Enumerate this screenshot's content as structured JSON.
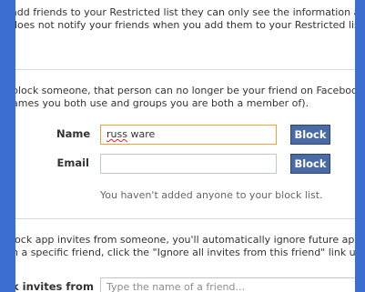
{
  "restricted_section": {
    "line1": "add friends to your Restricted list they can only see the information and p",
    "line2": "does not notify your friends when you add them to your Restricted list. Ec"
  },
  "block_users_section": {
    "line1": "block someone, that person can no longer be your friend on Facebook or i",
    "line2": "ames you both use and groups you are both a member of).",
    "name_label": "Name",
    "name_value": "russ",
    "name_value_rest": " ware",
    "email_label": "Email",
    "email_value": "",
    "block_button_label": "Block",
    "helper_text": "You haven't added anyone to your block list."
  },
  "block_app_invites_section": {
    "line1": "lock app invites from someone, you'll automatically ignore future app requ",
    "line2": "n a specific friend, click the \"Ignore all invites from this friend\" link under y",
    "label": "k invites from",
    "placeholder": "Type the name of a friend..."
  },
  "colors": {
    "frame_blue": "#3b6ed0",
    "button_blue": "#4a6aa5",
    "focus_orange": "#e8a33d"
  }
}
